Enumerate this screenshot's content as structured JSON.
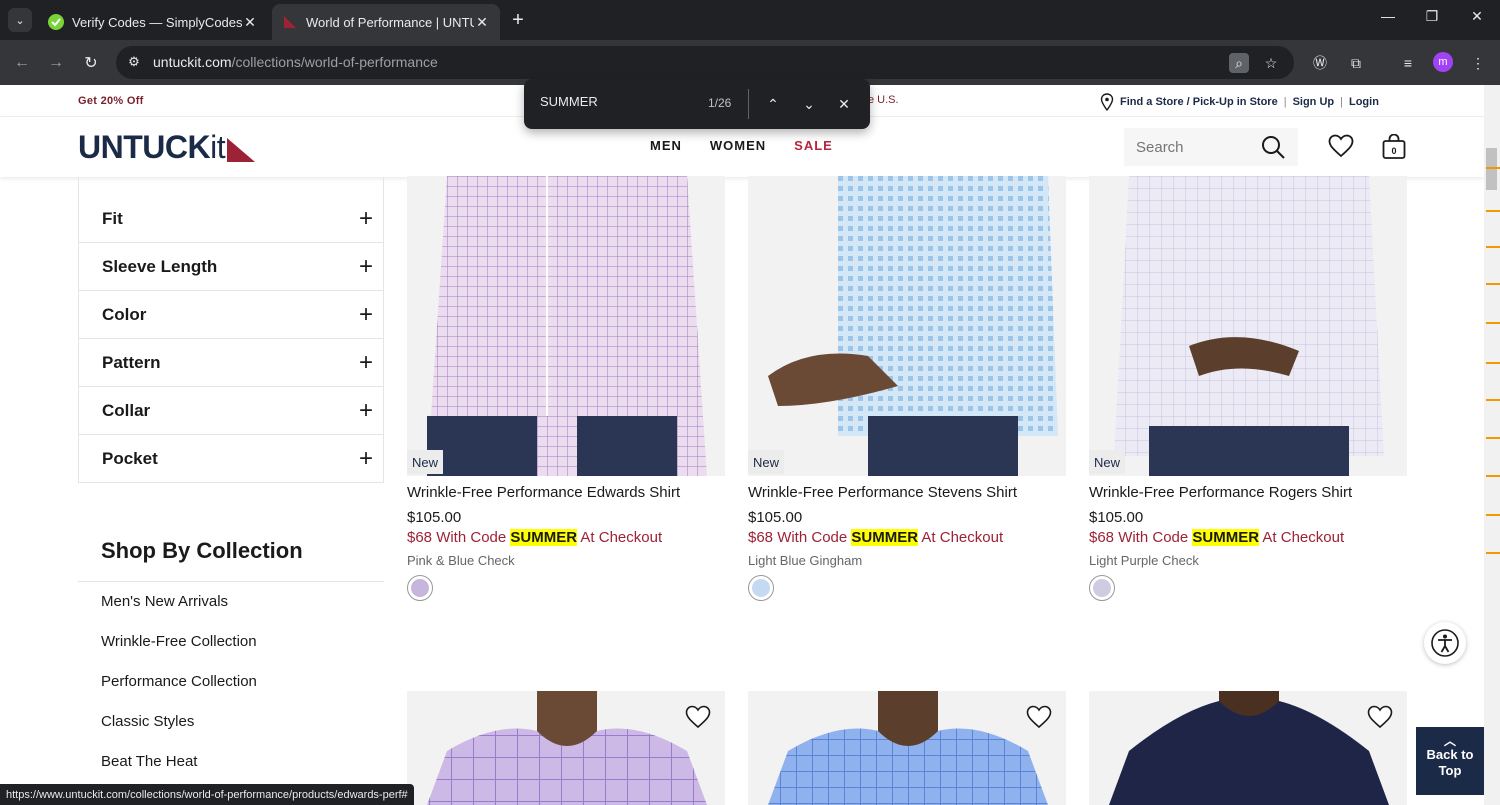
{
  "browser": {
    "tabs": [
      {
        "title": "Verify Codes — SimplyCodes",
        "active": false
      },
      {
        "title": "World of Performance | UNTUCKit",
        "active": true
      }
    ],
    "url_host": "untuckit.com",
    "url_path": "/collections/world-of-performance",
    "profile_initial": "m",
    "status_url": "https://www.untuckit.com/collections/world-of-performance/products/edwards-perf#"
  },
  "find": {
    "query": "SUMMER",
    "count": "1/26"
  },
  "promo": {
    "left": "Get 20% Off",
    "middle": "e U.S.",
    "store_link": "Find a Store / Pick-Up in Store",
    "signup": "Sign Up",
    "login": "Login",
    "separator": "|"
  },
  "header": {
    "logo_text": "UNTUCK",
    "logo_suffix": "it",
    "nav": [
      "MEN",
      "WOMEN",
      "SALE"
    ],
    "search_placeholder": "Search",
    "cart_count": "0"
  },
  "filters": [
    "Fit",
    "Sleeve Length",
    "Color",
    "Pattern",
    "Collar",
    "Pocket"
  ],
  "collection": {
    "title": "Shop By Collection",
    "items": [
      "Men's New Arrivals",
      "Wrinkle-Free Collection",
      "Performance Collection",
      "Classic Styles",
      "Beat The Heat"
    ]
  },
  "products": [
    {
      "badge": "New",
      "name": "Wrinkle-Free Performance Edwards Shirt",
      "price": "$105.00",
      "promo_pre": "$68 With Code ",
      "promo_code": "SUMMER",
      "promo_post": " At Checkout",
      "color": "Pink & Blue Check",
      "swatch": "#c7b6dc"
    },
    {
      "badge": "New",
      "name": "Wrinkle-Free Performance Stevens Shirt",
      "price": "$105.00",
      "promo_pre": "$68 With Code ",
      "promo_code": "SUMMER",
      "promo_post": " At Checkout",
      "color": "Light Blue Gingham",
      "swatch": "#c6d9f2"
    },
    {
      "badge": "New",
      "name": "Wrinkle-Free Performance Rogers Shirt",
      "price": "$105.00",
      "promo_pre": "$68 With Code ",
      "promo_code": "SUMMER",
      "promo_post": " At Checkout",
      "color": "Light Purple Check",
      "swatch": "#cfcbe0"
    }
  ],
  "back_to_top": "Back to Top",
  "colors": {
    "brand_navy": "#1b2a47",
    "brand_red": "#9d2235",
    "highlight": "#ffff00"
  }
}
